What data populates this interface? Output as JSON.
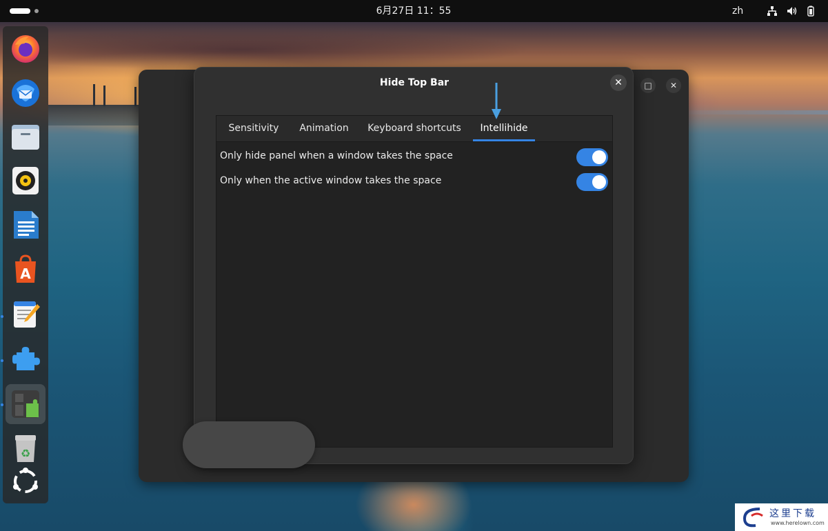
{
  "topbar": {
    "clock": "6月27日  11：55",
    "language": "zh",
    "tray_icons": [
      "network-icon",
      "volume-icon",
      "battery-icon"
    ]
  },
  "dock": {
    "items": [
      {
        "name": "firefox-icon",
        "running": false
      },
      {
        "name": "thunderbird-icon",
        "running": false
      },
      {
        "name": "files-icon",
        "running": false
      },
      {
        "name": "rhythmbox-icon",
        "running": false
      },
      {
        "name": "libreoffice-writer-icon",
        "running": false
      },
      {
        "name": "app-center-icon",
        "running": false
      },
      {
        "name": "text-editor-icon",
        "running": true
      },
      {
        "name": "extension-manager-icon",
        "running": true
      },
      {
        "name": "extensions-icon",
        "running": true
      },
      {
        "name": "trash-icon",
        "running": false
      },
      {
        "name": "show-apps-icon",
        "running": false
      }
    ]
  },
  "dialog": {
    "title": "Hide Top Bar",
    "close_symbol": "✕",
    "tabs": [
      {
        "label": "Sensitivity",
        "active": false
      },
      {
        "label": "Animation",
        "active": false
      },
      {
        "label": "Keyboard shortcuts",
        "active": false
      },
      {
        "label": "Intellihide",
        "active": true
      }
    ],
    "settings": [
      {
        "label": "Only hide panel when a window takes the space",
        "enabled": true
      },
      {
        "label": "Only when the active window takes the space",
        "enabled": true
      }
    ]
  },
  "background_window": {
    "maximize_symbol": "□",
    "close_symbol": "✕"
  },
  "watermark": {
    "text": "这里下载",
    "url": "www.herelown.com"
  },
  "colors": {
    "accent": "#3584e4",
    "dialog_bg": "#303030",
    "content_bg": "#222222",
    "topbar_bg": "#0f0f0f",
    "arrow": "#4a9fe0"
  }
}
